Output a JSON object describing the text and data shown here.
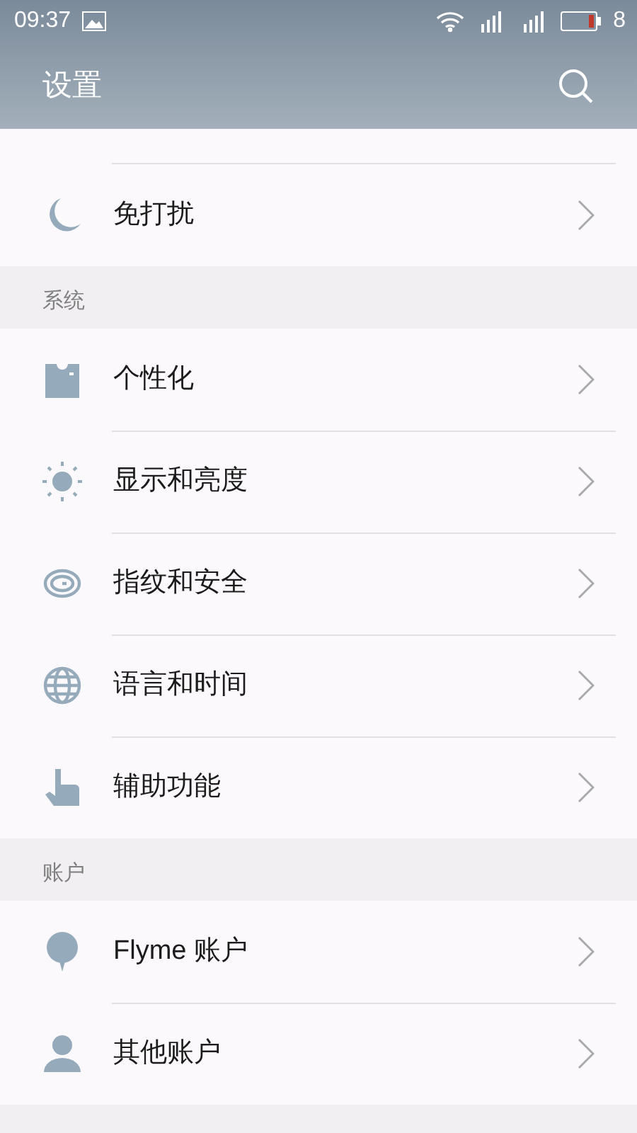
{
  "status_bar": {
    "time": "09:37",
    "battery_text": "8"
  },
  "title": "设置",
  "sections": [
    {
      "items": [
        {
          "label": "免打扰"
        }
      ]
    },
    {
      "header": "系统",
      "items": [
        {
          "label": "个性化"
        },
        {
          "label": "显示和亮度"
        },
        {
          "label": "指纹和安全"
        },
        {
          "label": "语言和时间"
        },
        {
          "label": "辅助功能"
        }
      ]
    },
    {
      "header": "账户",
      "items": [
        {
          "label": "Flyme 账户"
        },
        {
          "label": "其他账户"
        }
      ]
    }
  ]
}
